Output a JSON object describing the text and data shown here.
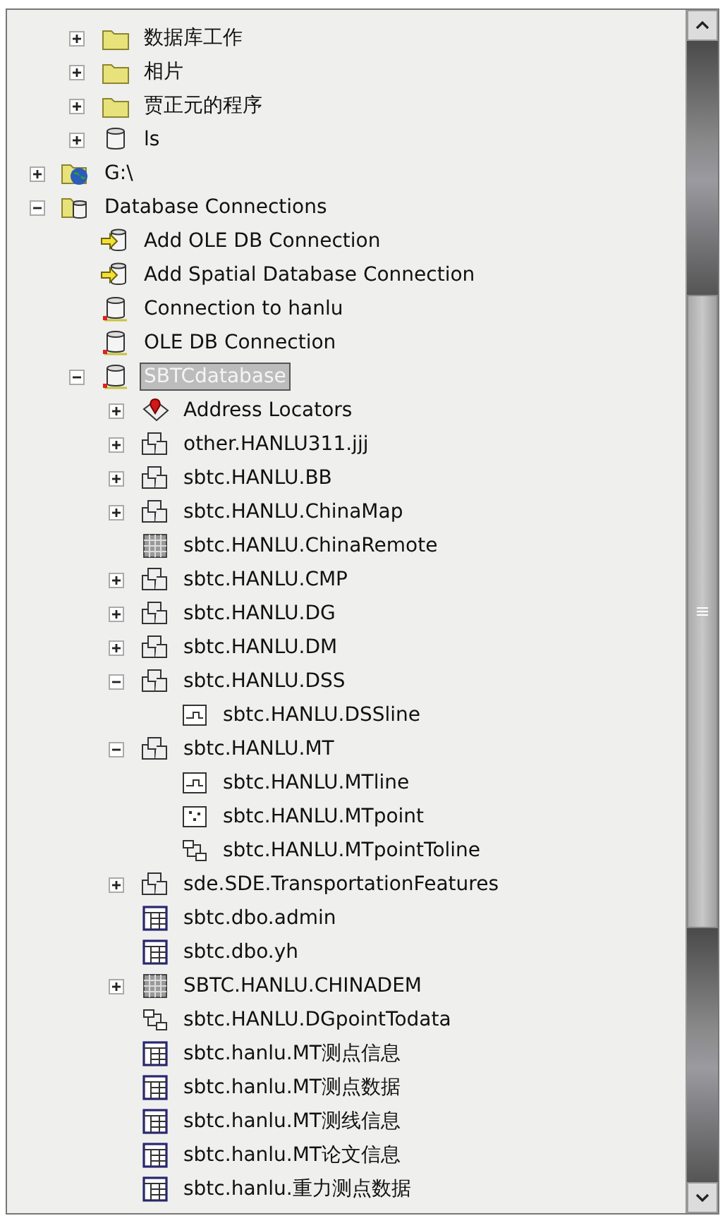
{
  "tree": [
    {
      "children": [
        {
          "label": "数据库工作",
          "kind": "folder",
          "expanded": false,
          "selected": false
        },
        {
          "label": "相片",
          "kind": "folder",
          "expanded": false,
          "selected": false
        },
        {
          "label": "贾正元的程序",
          "kind": "folder",
          "expanded": false,
          "selected": false
        },
        {
          "label": "ls",
          "kind": "database",
          "expanded": false,
          "selected": false
        }
      ]
    },
    {
      "label": "G:\\",
      "kind": "drive",
      "expanded": false,
      "selected": false
    },
    {
      "label": "Database Connections",
      "kind": "connections",
      "expanded": true,
      "selected": false,
      "children": [
        {
          "label": "Add OLE DB Connection",
          "kind": "add-connection",
          "selected": false
        },
        {
          "label": "Add Spatial Database Connection",
          "kind": "add-connection",
          "selected": false
        },
        {
          "label": "Connection to hanlu",
          "kind": "connection",
          "selected": false
        },
        {
          "label": "OLE DB Connection",
          "kind": "connection",
          "selected": false
        },
        {
          "label": "SBTCdatabase",
          "kind": "connection",
          "expanded": true,
          "selected": true,
          "children": [
            {
              "label": "Address Locators",
              "kind": "locator",
              "expanded": false,
              "selected": false
            },
            {
              "label": "other.HANLU311.jjj",
              "kind": "dataset",
              "expanded": false,
              "selected": false
            },
            {
              "label": "sbtc.HANLU.BB",
              "kind": "dataset",
              "expanded": false,
              "selected": false
            },
            {
              "label": "sbtc.HANLU.ChinaMap",
              "kind": "dataset",
              "expanded": false,
              "selected": false
            },
            {
              "label": "sbtc.HANLU.ChinaRemote",
              "kind": "raster-catalog",
              "selected": false
            },
            {
              "label": "sbtc.HANLU.CMP",
              "kind": "dataset",
              "expanded": false,
              "selected": false
            },
            {
              "label": "sbtc.HANLU.DG",
              "kind": "dataset",
              "expanded": false,
              "selected": false
            },
            {
              "label": "sbtc.HANLU.DM",
              "kind": "dataset",
              "expanded": false,
              "selected": false
            },
            {
              "label": "sbtc.HANLU.DSS",
              "kind": "dataset",
              "expanded": true,
              "selected": false,
              "children": [
                {
                  "label": "sbtc.HANLU.DSSline",
                  "kind": "line",
                  "selected": false
                }
              ]
            },
            {
              "label": "sbtc.HANLU.MT",
              "kind": "dataset",
              "expanded": true,
              "selected": false,
              "children": [
                {
                  "label": "sbtc.HANLU.MTline",
                  "kind": "line",
                  "selected": false
                },
                {
                  "label": "sbtc.HANLU.MTpoint",
                  "kind": "point",
                  "selected": false
                },
                {
                  "label": "sbtc.HANLU.MTpointToline",
                  "kind": "relationship",
                  "selected": false
                }
              ]
            },
            {
              "label": "sde.SDE.TransportationFeatures",
              "kind": "dataset",
              "expanded": false,
              "selected": false
            },
            {
              "label": "sbtc.dbo.admin",
              "kind": "table",
              "selected": false
            },
            {
              "label": "sbtc.dbo.yh",
              "kind": "table",
              "selected": false
            },
            {
              "label": "SBTC.HANLU.CHINADEM",
              "kind": "raster",
              "expanded": false,
              "selected": false
            },
            {
              "label": "sbtc.HANLU.DGpointTodata",
              "kind": "relationship",
              "selected": false
            },
            {
              "label": "sbtc.hanlu.MT测点信息",
              "kind": "table",
              "selected": false
            },
            {
              "label": "sbtc.hanlu.MT测点数据",
              "kind": "table",
              "selected": false
            },
            {
              "label": "sbtc.hanlu.MT测线信息",
              "kind": "table",
              "selected": false
            },
            {
              "label": "sbtc.hanlu.MT论文信息",
              "kind": "table",
              "selected": false
            },
            {
              "label": "sbtc.hanlu.重力测点数据",
              "kind": "table",
              "selected": false
            }
          ]
        }
      ]
    }
  ]
}
